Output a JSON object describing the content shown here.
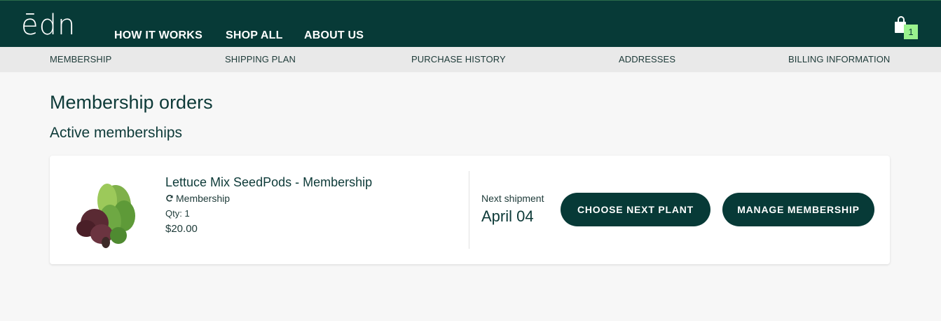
{
  "header": {
    "logo_text": "ēdn",
    "nav": [
      "HOW IT WORKS",
      "SHOP ALL",
      "ABOUT US"
    ],
    "cart_count": "1",
    "cart_icon": "shopping-bag-icon",
    "background": "#073a37"
  },
  "subnav": {
    "items": [
      "MEMBERSHIP",
      "SHIPPING PLAN",
      "PURCHASE HISTORY",
      "ADDRESSES",
      "BILLING INFORMATION"
    ]
  },
  "page": {
    "title": "Membership orders",
    "section_title": "Active memberships"
  },
  "membership": {
    "product_name": "Lettuce Mix SeedPods - Membership",
    "type_icon": "refresh-icon",
    "type_label": "Membership",
    "qty": "Qty: 1",
    "price": "$20.00",
    "next_shipment_label": "Next shipment",
    "next_shipment_date": "April 04",
    "choose_button": "CHOOSE NEXT PLANT",
    "manage_button": "MANAGE MEMBERSHIP"
  },
  "colors": {
    "brand_dark": "#073a37",
    "badge": "#9af28e",
    "subnav_bg": "#e9e9e9",
    "page_bg": "#f7f7f7"
  }
}
